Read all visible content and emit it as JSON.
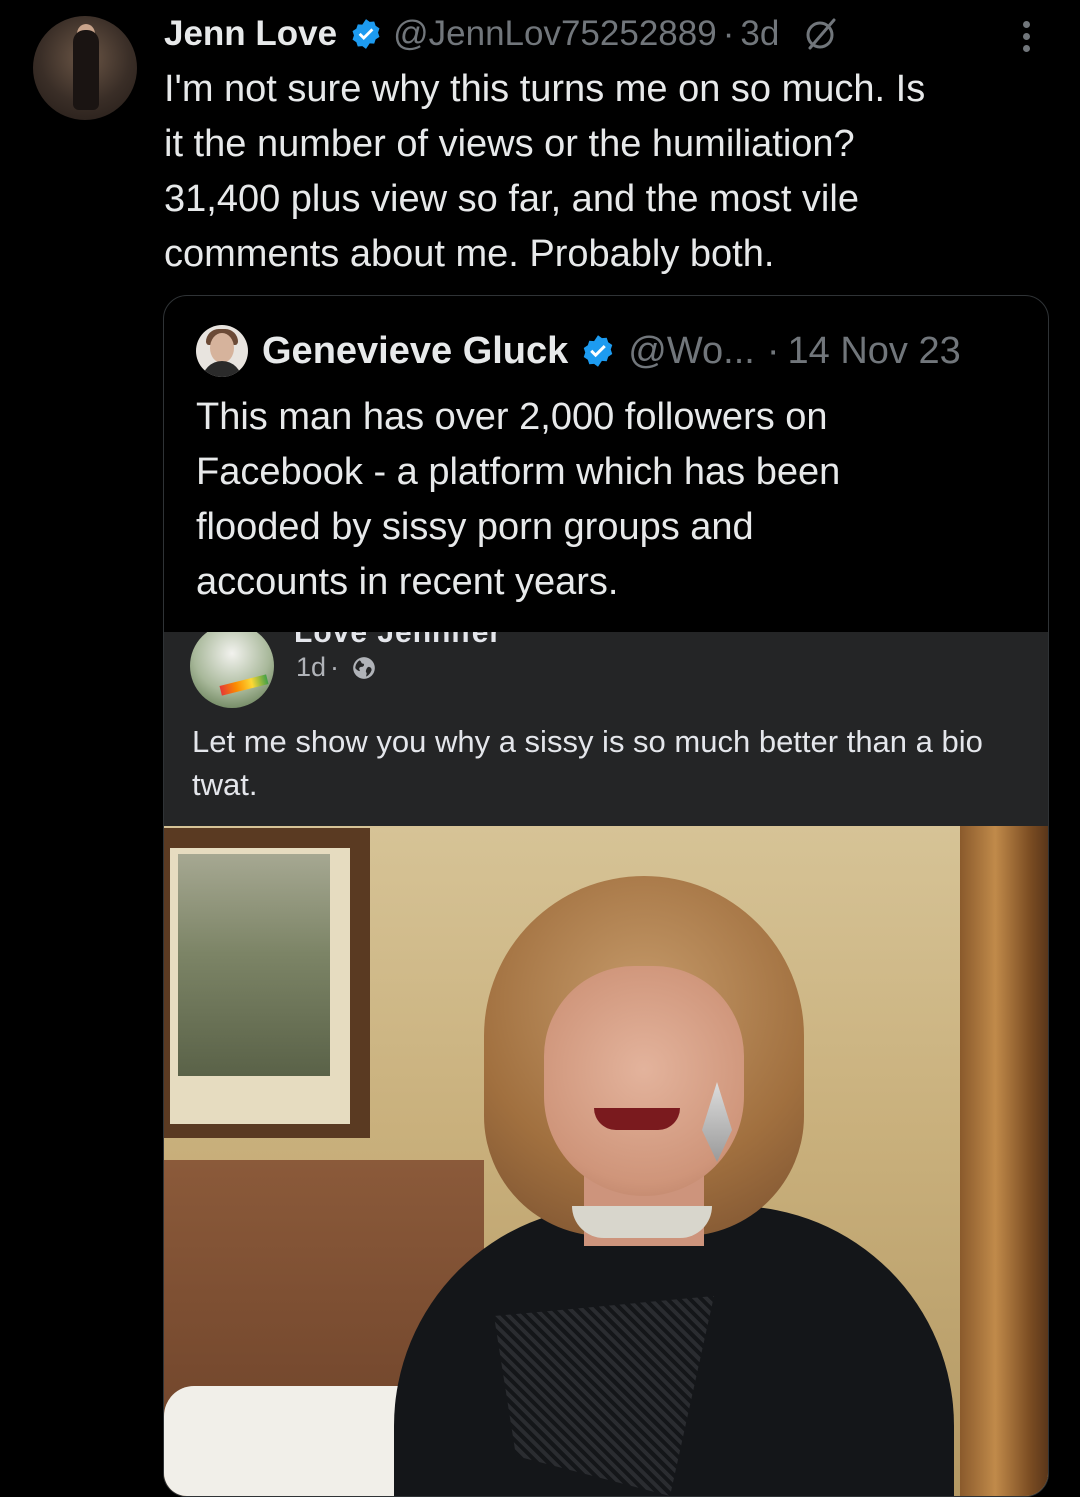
{
  "tweet": {
    "author_name": "Jenn Love",
    "handle": "@JennLov75252889",
    "separator": "·",
    "time": "3d",
    "text_lines": [
      "I'm not sure why this turns me on so much.  Is",
      "it the number of views or the humiliation?",
      "31,400 plus view so far, and the most vile",
      "comments about me. Probably both."
    ]
  },
  "quote": {
    "author_name": "Genevieve Gluck",
    "handle": "@Wo...",
    "separator": "·",
    "date": "14 Nov 23",
    "text_lines": [
      "This man has over 2,000 followers on",
      "Facebook - a platform which has been",
      "flooded by sissy porn groups and",
      "accounts in recent years."
    ],
    "embedded_post": {
      "name_partial": "Love Jennifer",
      "time": "1d",
      "dot": "·",
      "text": "Let me show you why a sissy is so much better than a bio twat."
    }
  },
  "colors": {
    "background": "#000000",
    "text_primary": "#e7e9ea",
    "text_secondary": "#71767b",
    "verified_blue": "#1d9bf0",
    "fb_card": "#242526"
  },
  "icons": [
    "verified-badge-icon",
    "grok-icon",
    "more-options-icon",
    "globe-icon"
  ]
}
